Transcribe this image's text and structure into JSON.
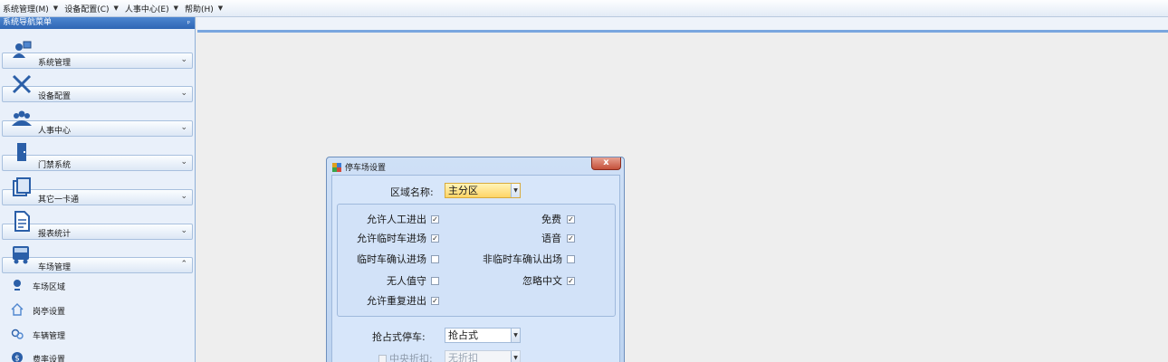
{
  "menubar": {
    "items": [
      {
        "label": "系统管理(M)"
      },
      {
        "label": "设备配置(C)"
      },
      {
        "label": "人事中心(E)"
      },
      {
        "label": "帮助(H)"
      }
    ]
  },
  "sidebar": {
    "title": "系统导航菜单",
    "pin": "ᵖ",
    "groups": [
      {
        "label": "系统管理",
        "icon": "admin-icon",
        "state": "collapsed"
      },
      {
        "label": "设备配置",
        "icon": "tools-icon",
        "state": "collapsed"
      },
      {
        "label": "人事中心",
        "icon": "people-icon",
        "state": "collapsed"
      },
      {
        "label": "门禁系统",
        "icon": "door-icon",
        "state": "collapsed"
      },
      {
        "label": "其它一卡通",
        "icon": "card-icon",
        "state": "collapsed"
      },
      {
        "label": "报表统计",
        "icon": "report-icon",
        "state": "collapsed"
      },
      {
        "label": "车场管理",
        "icon": "parking-icon",
        "state": "expanded"
      }
    ],
    "subitems": [
      {
        "label": "车场区域",
        "icon": "pin-icon"
      },
      {
        "label": "岗亭设置",
        "icon": "house-icon"
      },
      {
        "label": "车辆管理",
        "icon": "car-icon"
      },
      {
        "label": "费率设置",
        "icon": "coin-icon"
      }
    ],
    "chevron_down": "⌄",
    "chevron_up": "⌃"
  },
  "dialog": {
    "title": "停车场设置",
    "close": "x",
    "area_label": "区域名称:",
    "area_value": "主分区",
    "options": [
      {
        "label": "允许人工进出",
        "checked": true
      },
      {
        "label": "免费",
        "checked": true
      },
      {
        "label": "允许临时车进场",
        "checked": true
      },
      {
        "label": "语音",
        "checked": true
      },
      {
        "label": "临时车确认进场",
        "checked": false
      },
      {
        "label": "非临时车确认出场",
        "checked": false
      },
      {
        "label": "无人值守",
        "checked": false
      },
      {
        "label": "忽略中文",
        "checked": true
      },
      {
        "label": "允许重复进出",
        "checked": true
      }
    ],
    "grab_label": "抢占式停车:",
    "grab_value": "抢占式",
    "central_label": "中央折扣:",
    "central_checked": false,
    "discount_value": "无折扣"
  },
  "colors": {
    "accent": "#2f66b4",
    "highlight": "#ffd566"
  }
}
